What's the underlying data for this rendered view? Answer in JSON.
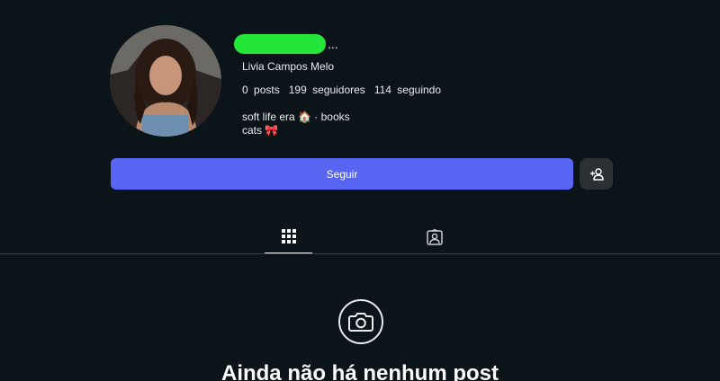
{
  "profile": {
    "display_name": "Livia Campos Melo",
    "username_suffix": "...",
    "stats": {
      "posts_count": "0",
      "posts_label": "posts",
      "followers_count": "199",
      "followers_label": "seguidores",
      "following_count": "114",
      "following_label": "seguindo"
    },
    "bio_line1": "soft life era 🏠 · books",
    "bio_line2": "cats 🎀"
  },
  "actions": {
    "follow_label": "Seguir"
  },
  "tabs": {
    "posts_icon": "grid-icon",
    "tagged_icon": "tagged-user-icon"
  },
  "empty_state": {
    "icon": "camera-icon",
    "title": "Ainda não há nenhum post"
  },
  "colors": {
    "background": "#0b1418",
    "accent": "#5865f2",
    "redaction": "#24e63a"
  }
}
